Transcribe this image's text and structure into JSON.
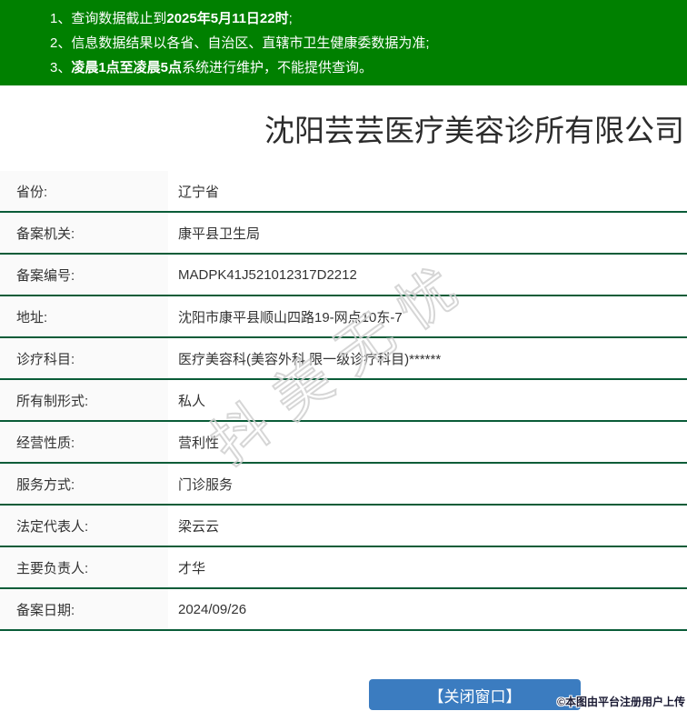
{
  "notices": {
    "items": [
      {
        "num": "1、",
        "pre": "查询数据截止到",
        "bold": "2025年5月11日22时",
        "post": ";"
      },
      {
        "num": "2、",
        "pre": "信息数据结果以各省、自治区、直辖市卫生健康委数据为准;",
        "bold": "",
        "post": ""
      },
      {
        "num": "3、",
        "pre": "",
        "bold": "凌晨1点至凌晨5点",
        "post": "系统进行维护，不能提供查询。"
      }
    ]
  },
  "title": "沈阳芸芸医疗美容诊所有限公司",
  "table": {
    "rows": [
      {
        "label": "省份:",
        "value": "辽宁省"
      },
      {
        "label": "备案机关:",
        "value": "康平县卫生局"
      },
      {
        "label": "备案编号:",
        "value": "MADPK41J521012317D2212"
      },
      {
        "label": "地址:",
        "value": "沈阳市康平县顺山四路19-网点10东-7"
      },
      {
        "label": "诊疗科目:",
        "value": "医疗美容科(美容外科 限一级诊疗科目)******"
      },
      {
        "label": "所有制形式:",
        "value": "私人"
      },
      {
        "label": "经营性质:",
        "value": "营利性"
      },
      {
        "label": "服务方式:",
        "value": "门诊服务"
      },
      {
        "label": "法定代表人:",
        "value": "梁云云"
      },
      {
        "label": "主要负责人:",
        "value": "才华"
      },
      {
        "label": "备案日期:",
        "value": "2024/09/26"
      }
    ]
  },
  "watermark_text": "抖美无忧",
  "close_button_label": "【关闭窗口】",
  "copyright_text": "©本图由平台注册用户上传",
  "colors": {
    "banner_green": "#008000",
    "divider_green": "#0a5c38",
    "label_bg": "#fafafa",
    "button_blue": "#3b7cc0",
    "watermark_gray": "#cfcfcf"
  }
}
